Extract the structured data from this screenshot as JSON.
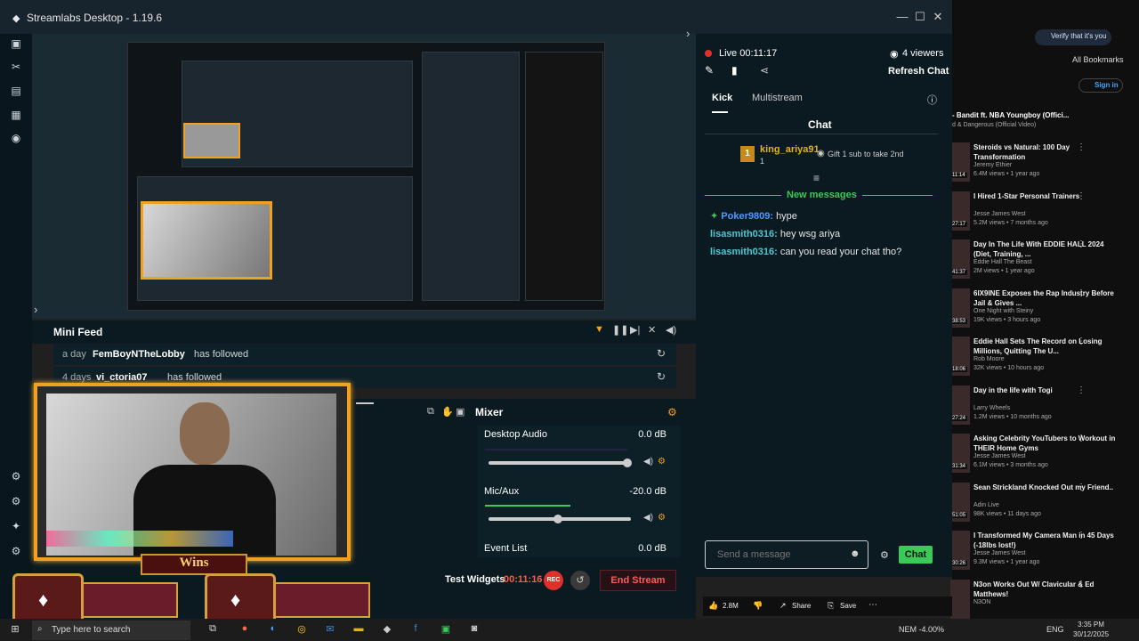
{
  "window": {
    "title": "Streamlabs Desktop - 1.19.6",
    "minimize": "—",
    "maximize": "☐",
    "close": "✕"
  },
  "nav": {
    "items": [
      "studio-icon",
      "themes-icon",
      "store-icon",
      "media-icon",
      "live-icon",
      "settings-icon"
    ]
  },
  "mini_feed": {
    "title": "Mini Feed",
    "rows": [
      {
        "time": "a day",
        "user": "FemBoyNTheLobby",
        "action": "has followed"
      },
      {
        "time": "4 days",
        "user": "vi_ctoria07",
        "action": "has followed"
      }
    ]
  },
  "mixer": {
    "title": "Mixer",
    "channels": [
      {
        "name": "Desktop Audio",
        "db": "0.0 dB",
        "level": 0.0,
        "fader": 0.9
      },
      {
        "name": "Mic/Aux",
        "db": "-20.0 dB",
        "level": 0.6,
        "fader": 0.5
      },
      {
        "name": "Event List",
        "db": "0.0 dB",
        "level": 0.0,
        "fader": 0.0
      }
    ]
  },
  "overlay": {
    "banner": "Wins"
  },
  "controls": {
    "test_widgets": "Test Widgets",
    "rec_time": "00:11:16",
    "rec_label": "REC",
    "end_stream": "End Stream"
  },
  "chat": {
    "live_status": "Live 00:11:17",
    "viewers": "4 viewers",
    "refresh": "Refresh Chat",
    "tabs": [
      "Kick",
      "Multistream"
    ],
    "heading": "Chat",
    "pinned": {
      "badge": "1",
      "user": "king_ariya91",
      "count": "1",
      "gift_text": "Gift 1 sub to take 2nd"
    },
    "new_messages_label": "New messages",
    "messages": [
      {
        "user": "Poker9809:",
        "text": "hype"
      },
      {
        "user": "lisasmith0316:",
        "text": "hey wsg ariya"
      },
      {
        "user": "lisasmith0316:",
        "text": "can you read your chat tho?"
      }
    ],
    "input_placeholder": "Send a message",
    "send_label": "Chat"
  },
  "browser": {
    "verify_label": "Verify that it's you",
    "all_bookmarks": "All Bookmarks",
    "sign_in": "Sign in",
    "now_playing": "- Bandit ft. NBA Youngboy (Offici...",
    "now_playing_sub": "d & Dangerous (Official Video)",
    "videos": [
      {
        "title": "Steroids vs Natural: 100 Day Transformation",
        "channel": "Jeremy Ethier",
        "meta": "6.4M views • 1 year ago",
        "duration": "11:14"
      },
      {
        "title": "I Hired 1-Star Personal Trainers",
        "channel": "Jesse James West",
        "meta": "5.2M views • 7 months ago",
        "duration": "27:17"
      },
      {
        "title": "Day In The Life With EDDIE HALL 2024 (Diet, Training, ...",
        "channel": "Eddie Hall The Beast",
        "meta": "2M views • 1 year ago",
        "duration": "41:37"
      },
      {
        "title": "6IX9INE Exposes the Rap Industry Before Jail & Gives ...",
        "channel": "One Night with Steiny",
        "meta": "19K views • 3 hours ago",
        "duration": "38:53"
      },
      {
        "title": "Eddie Hall Sets The Record on Losing Millions, Quitting The U...",
        "channel": "Rob Moore",
        "meta": "32K views • 10 hours ago",
        "duration": "18:06"
      },
      {
        "title": "Day in the life with Togi",
        "channel": "Larry Wheels",
        "meta": "1.2M views • 10 months ago",
        "duration": "27:24"
      },
      {
        "title": "Asking Celebrity YouTubers to Workout in THEIR Home Gyms",
        "channel": "Jesse James West",
        "meta": "6.1M views • 3 months ago",
        "duration": "31:34"
      },
      {
        "title": "Sean Strickland Knocked Out my Friend..",
        "channel": "Adin Live",
        "meta": "98K views • 11 days ago",
        "duration": "51:05"
      },
      {
        "title": "I Transformed My Camera Man in 45 Days (-18lbs lost!)",
        "channel": "Jesse James West",
        "meta": "9.3M views • 1 year ago",
        "duration": "30:26"
      },
      {
        "title": "N3on Works Out W/ Clavicular & Ed Matthews!",
        "channel": "N3ON",
        "meta": "",
        "duration": ""
      }
    ],
    "actions": {
      "likes": "2.8M",
      "share": "Share",
      "save": "Save"
    }
  },
  "taskbar": {
    "search_placeholder": "Type here to search",
    "tray": "NEM  -4.00%",
    "lang": "ENG",
    "time": "3:35 PM",
    "date": "30/12/2025"
  }
}
